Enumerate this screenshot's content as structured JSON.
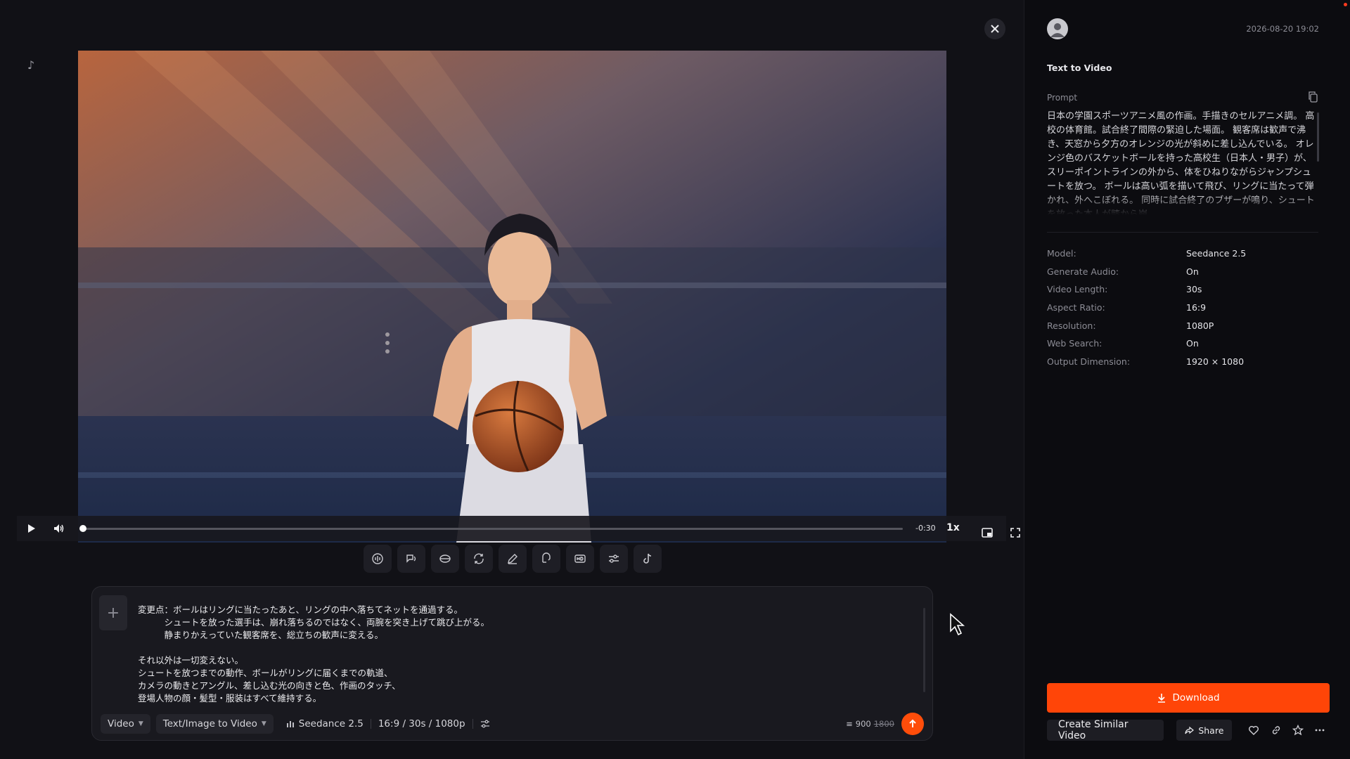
{
  "header": {
    "close_icon": "close-icon",
    "brand_icon": "tiktok-note-icon"
  },
  "player": {
    "time_remaining": "-0:30",
    "playback_rate": "1x",
    "progress": 0.0
  },
  "tools": [
    {
      "icon": "sound-effect-icon"
    },
    {
      "icon": "lip-sync-icon"
    },
    {
      "icon": "lens-icon"
    },
    {
      "icon": "loop-icon"
    },
    {
      "icon": "edit-pencil-icon"
    },
    {
      "icon": "voice-icon"
    },
    {
      "icon": "hd-upscale-icon"
    },
    {
      "icon": "adjust-sliders-icon"
    },
    {
      "icon": "tiktok-icon"
    }
  ],
  "composer": {
    "text": "変更点：ボールはリングに当たったあと、リングの中へ落ちてネットを通過する。\n　　　シュートを放った選手は、崩れ落ちるのではなく、両腕を突き上げて跳び上がる。\n　　　静まりかえっていた観客席を、総立ちの歓声に変える。\n\nそれ以外は一切変えない。\nシュートを放つまでの動作、ボールがリングに届くまでの軌道、\nカメラの動きとアングル、差し込む光の向きと色、作画のタッチ、\n登場人物の顔・髪型・服装はすべて維持する。",
    "mode_label": "Video",
    "type_label": "Text/Image to Video",
    "model_label": "Seedance 2.5",
    "params_label": "16:9 / 30s / 1080p",
    "credits": "900",
    "credits_original": "1800"
  },
  "details": {
    "timestamp": "2026-08-20 19:02",
    "generation_type": "Text to Video",
    "prompt_label": "Prompt",
    "prompt_text": "日本の学園スポーツアニメ風の作画。手描きのセルアニメ調。 高校の体育館。試合終了間際の緊迫した場面。 観客席は歓声で沸き、天窓から夕方のオレンジの光が斜めに差し込んでいる。 オレンジ色のバスケットボールを持った高校生（日本人・男子）が、 スリーポイントラインの外から、体をひねりながらジャンプシュートを放つ。 ボールは高い弧を描いて飛び、リングに当たって弾かれ、外へこぼれる。 同時に試合終了のブザーが鳴り、シュートを放った本人が膝から崩",
    "specs": [
      {
        "key": "Model:",
        "value": "Seedance 2.5"
      },
      {
        "key": "Generate Audio:",
        "value": "On"
      },
      {
        "key": "Video Length:",
        "value": "30s"
      },
      {
        "key": "Aspect Ratio:",
        "value": "16:9"
      },
      {
        "key": "Resolution:",
        "value": "1080P"
      },
      {
        "key": "Web Search:",
        "value": "On"
      },
      {
        "key": "Output Dimension:",
        "value": "1920 × 1080"
      }
    ]
  },
  "actions": {
    "download_label": "Download",
    "create_similar_label": "Create Similar Video",
    "share_label": "Share"
  },
  "colors": {
    "accent": "#ff4508",
    "background": "#0c0c10"
  }
}
